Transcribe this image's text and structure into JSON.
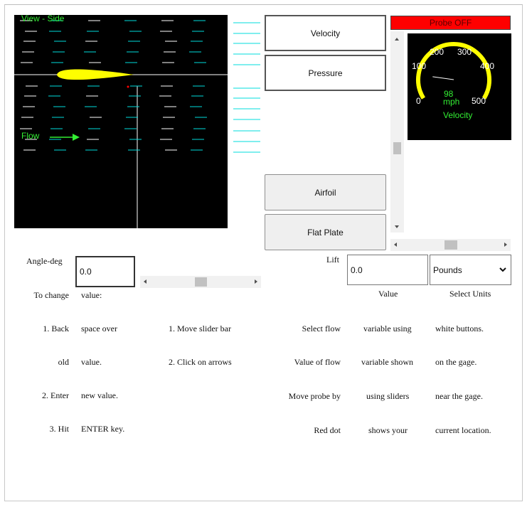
{
  "view": {
    "title": "View - Side",
    "flow_label": "Flow",
    "colors": {
      "background": "#000000",
      "airfoil": "#ffff00",
      "streamline_white": "#ffffff",
      "streamline_cyan": "#00dddd",
      "label": "#33ee33",
      "probe_dot": "#ff0000"
    }
  },
  "buttons": {
    "velocity": "Velocity",
    "pressure": "Pressure",
    "airfoil": "Airfoil",
    "flat_plate": "Flat Plate"
  },
  "probe": {
    "status": "Probe OFF",
    "color": "#ff0000"
  },
  "gauge": {
    "ticks": [
      "0",
      "100",
      "200",
      "300",
      "400",
      "500"
    ],
    "value_text": "98",
    "unit": "mph",
    "label": "Velocity",
    "value": 98,
    "min": 0,
    "max": 500,
    "color": "#ffff00",
    "text_color": "#33ee33"
  },
  "angle": {
    "label": "Angle-deg",
    "value": "0.0",
    "slider_fraction": 0.5
  },
  "lift": {
    "label": "Lift",
    "value": "0.0",
    "units_selected": "Pounds",
    "value_caption": "Value",
    "units_caption": "Select Units"
  },
  "probe_sliders": {
    "vertical_fraction": 0.6,
    "horizontal_fraction": 0.5
  },
  "instructions": {
    "left": [
      [
        "To change",
        "value:",
        ""
      ],
      [
        "1. Back",
        "space over",
        "1. Move slider bar"
      ],
      [
        "old",
        "value.",
        "2. Click on arrows"
      ],
      [
        "2. Enter",
        "new value.",
        ""
      ],
      [
        "3. Hit",
        "ENTER key.",
        ""
      ]
    ],
    "right": [
      [
        "Select flow",
        "variable using",
        "white buttons."
      ],
      [
        "Value of flow",
        "variable shown",
        "on the gage."
      ],
      [
        "Move probe by",
        "using sliders",
        "near the gage."
      ],
      [
        "Red dot",
        "shows your",
        "current location."
      ]
    ]
  }
}
